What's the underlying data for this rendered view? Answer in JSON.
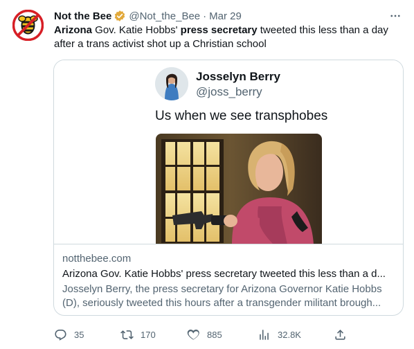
{
  "tweet": {
    "author_name": "Not the Bee",
    "author_handle": "@Not_the_Bee",
    "separator": "·",
    "date": "Mar 29",
    "more_icon": "more-horizontal-icon",
    "verified_badge_color": "#e2a93b",
    "text": {
      "part1": "Arizona",
      "part2": " Gov. Katie Hobbs' ",
      "part3": "press secretary",
      "part4": " tweeted this less than a day after a trans activist shot up a Christian school"
    }
  },
  "card": {
    "embedded": {
      "name": "Josselyn Berry",
      "handle": "@joss_berry",
      "text": "Us when we see transphobes"
    },
    "domain": "notthebee.com",
    "title": "Arizona Gov. Katie Hobbs' press secretary tweeted this less than a d...",
    "description": "Josselyn Berry, the press secretary for Arizona Governor Katie Hobbs (D), seriously tweeted this hours after a transgender militant brough..."
  },
  "actions": {
    "replies": "35",
    "retweets": "170",
    "likes": "885",
    "views": "32.8K"
  },
  "colors": {
    "logo_red": "#d71f26",
    "logo_yellow": "#f3c31d",
    "secondary_text": "#536471",
    "border": "#cfd9de"
  }
}
